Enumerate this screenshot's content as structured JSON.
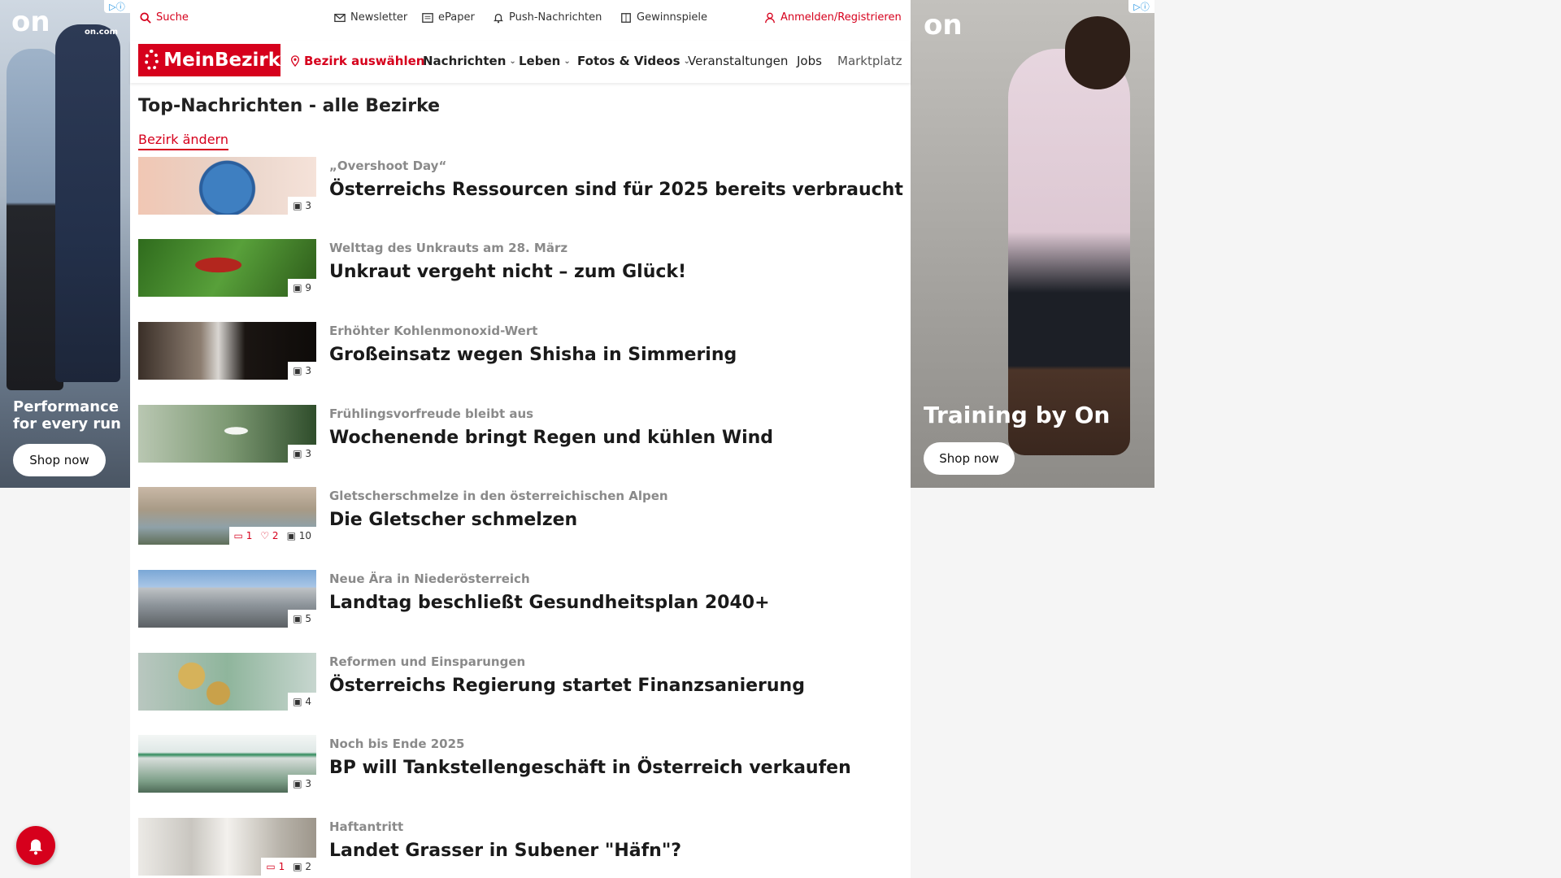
{
  "ads": {
    "left": {
      "brand": "on",
      "domain": "on.com",
      "headline": "Performance for every run",
      "cta": "Shop now",
      "adchoice": "▷ⓘ"
    },
    "right": {
      "brand": "on",
      "headline": "Training by On",
      "cta": "Shop now",
      "adchoice": "▷ⓘ"
    }
  },
  "topbar": {
    "search": "Suche",
    "newsletter": "Newsletter",
    "epaper": "ePaper",
    "push": "Push-Nachrichten",
    "games": "Gewinnspiele",
    "login": "Anmelden/Registrieren"
  },
  "nav": {
    "logo": "MeinBezirk",
    "select_district": "Bezirk auswählen",
    "items": [
      "Nachrichten",
      "Leben",
      "Fotos & Videos",
      "Veranstaltungen",
      "Jobs",
      "Marktplatz"
    ]
  },
  "page": {
    "title": "Top-Nachrichten - alle Bezirke",
    "change_district": "Bezirk ändern"
  },
  "articles": [
    {
      "kicker": "„Overshoot Day“",
      "headline": "Österreichs Ressourcen sind für 2025 bereits verbraucht",
      "photos": "3",
      "comments": "",
      "likes": ""
    },
    {
      "kicker": "Welttag des Unkrauts am 28. März",
      "headline": "Unkraut vergeht nicht – zum Glück!",
      "photos": "9",
      "comments": "",
      "likes": ""
    },
    {
      "kicker": "Erhöhter Kohlenmonoxid-Wert",
      "headline": "Großeinsatz wegen Shisha in Simmering",
      "photos": "3",
      "comments": "",
      "likes": ""
    },
    {
      "kicker": "Frühlingsvorfreude bleibt aus",
      "headline": "Wochenende bringt Regen und kühlen Wind",
      "photos": "3",
      "comments": "",
      "likes": ""
    },
    {
      "kicker": "Gletscherschmelze in den österreichischen Alpen",
      "headline": "Die Gletscher schmelzen",
      "photos": "10",
      "comments": "1",
      "likes": "2"
    },
    {
      "kicker": "Neue Ära in Niederösterreich",
      "headline": "Landtag beschließt Gesundheitsplan 2040+",
      "photos": "5",
      "comments": "",
      "likes": ""
    },
    {
      "kicker": "Reformen und Einsparungen",
      "headline": "Österreichs Regierung startet Finanzsanierung",
      "photos": "4",
      "comments": "",
      "likes": ""
    },
    {
      "kicker": "Noch bis Ende 2025",
      "headline": "BP will Tankstellengeschäft in Österreich verkaufen",
      "photos": "3",
      "comments": "",
      "likes": ""
    },
    {
      "kicker": "Haftantritt",
      "headline": "Landet Grasser in Subener \"Häfn\"?",
      "photos": "2",
      "comments": "1",
      "likes": ""
    }
  ],
  "colors": {
    "brand_red": "#d6001c",
    "kicker_gray": "#8a8a8a"
  }
}
